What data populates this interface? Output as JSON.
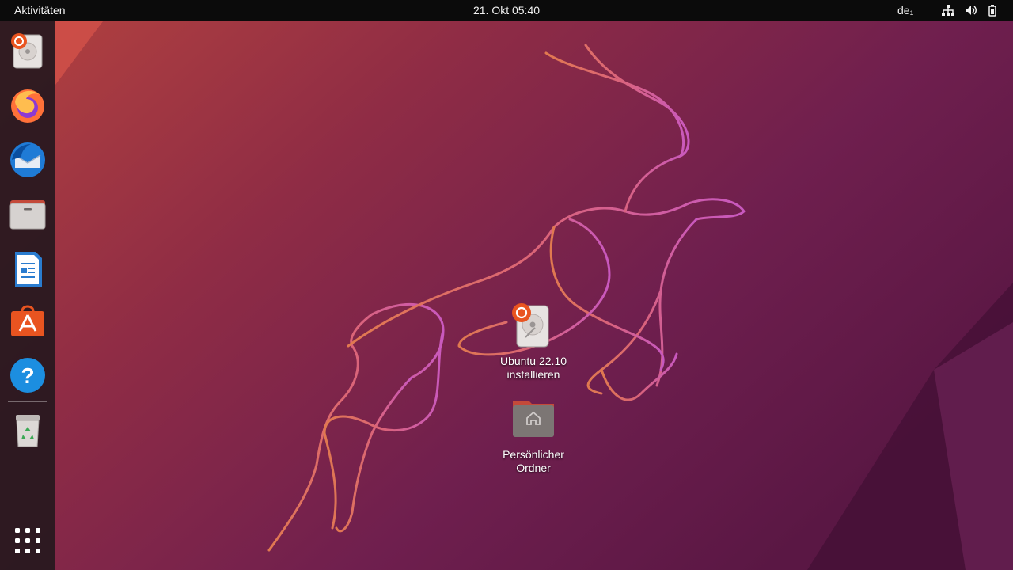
{
  "topbar": {
    "activities_label": "Aktivitäten",
    "clock": "21. Okt  05:40",
    "keyboard_layout": "de₁",
    "tray_icons": [
      "network-icon",
      "volume-icon",
      "battery-icon"
    ]
  },
  "dock": {
    "items": [
      {
        "name": "ubuntu-installer",
        "icon": "ubuntu-installer-icon"
      },
      {
        "name": "firefox",
        "icon": "firefox-icon"
      },
      {
        "name": "thunderbird",
        "icon": "thunderbird-icon"
      },
      {
        "name": "files",
        "icon": "files-icon"
      },
      {
        "name": "libreoffice-writer",
        "icon": "writer-icon"
      },
      {
        "name": "ubuntu-software",
        "icon": "software-icon"
      },
      {
        "name": "help",
        "icon": "help-icon"
      },
      {
        "name": "trash",
        "icon": "trash-icon"
      }
    ],
    "show_apps_icon": "app-grid-icon"
  },
  "desktop": {
    "icons": [
      {
        "label": "Ubuntu 22.10\ninstallieren",
        "icon": "ubuntu-installer-icon"
      },
      {
        "label": "Persönlicher\nOrdner",
        "icon": "home-folder-icon"
      }
    ]
  },
  "colors": {
    "wallpaper_left": "#b0403f",
    "wallpaper_right": "#6e1d4f",
    "ubuntu_orange": "#e95420",
    "topbar_bg": "#0b0b0b"
  }
}
